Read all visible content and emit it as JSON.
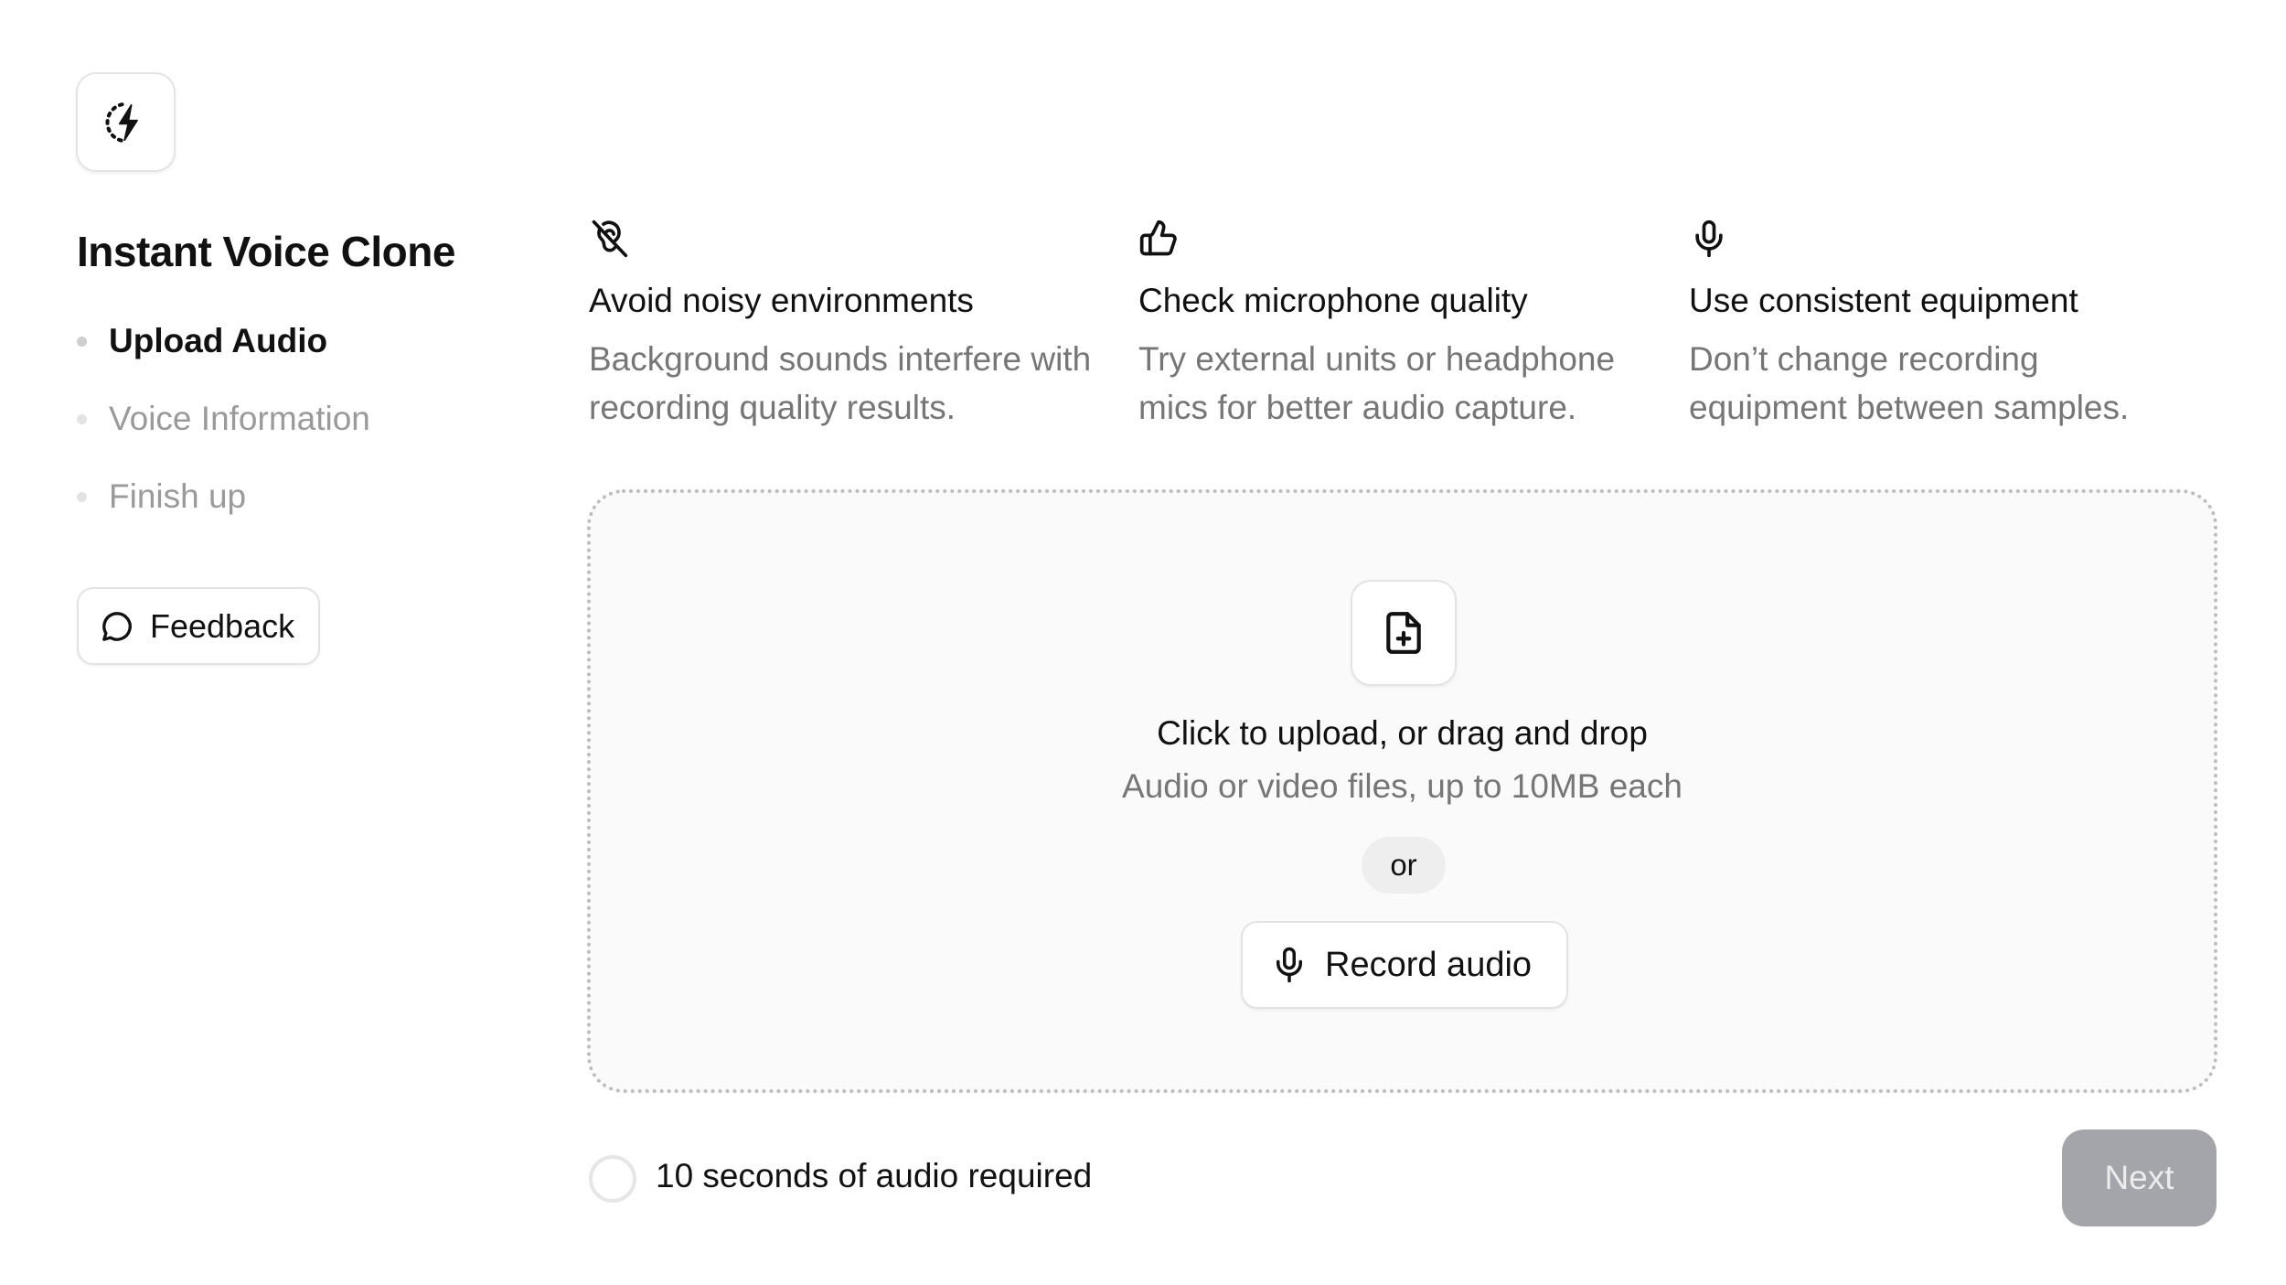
{
  "app": {
    "icon": "voice-clone-logo-icon",
    "title": "Instant Voice Clone"
  },
  "steps": [
    {
      "label": "Upload Audio",
      "state": "active"
    },
    {
      "label": "Voice Information",
      "state": "pending"
    },
    {
      "label": "Finish up",
      "state": "pending"
    }
  ],
  "feedback": {
    "label": "Feedback",
    "icon": "speech-bubble-icon"
  },
  "tips": [
    {
      "icon": "ear-off-icon",
      "title": "Avoid noisy environments",
      "description": "Background sounds interfere with recording quality results."
    },
    {
      "icon": "thumbs-up-icon",
      "title": "Check microphone quality",
      "description": "Try external units or headphone mics for better audio capture."
    },
    {
      "icon": "microphone-icon",
      "title": "Use consistent equipment",
      "description": "Don’t change recording equipment between samples."
    }
  ],
  "upload": {
    "icon": "file-plus-icon",
    "title": "Click to upload, or drag and drop",
    "subtitle": "Audio or video files, up to 10MB each",
    "or_label": "or",
    "record_label": "Record audio",
    "record_icon": "microphone-icon"
  },
  "footer": {
    "progress_label": "10 seconds of audio required",
    "progress_fraction": 0,
    "next_label": "Next",
    "next_enabled": false
  },
  "colors": {
    "primary_text": "#111111",
    "muted_text": "#767676",
    "disabled_step": "#9a9a9a",
    "border": "#e3e3e3",
    "dropzone_bg": "#fafafa",
    "next_disabled_bg": "#a4a5aa"
  }
}
